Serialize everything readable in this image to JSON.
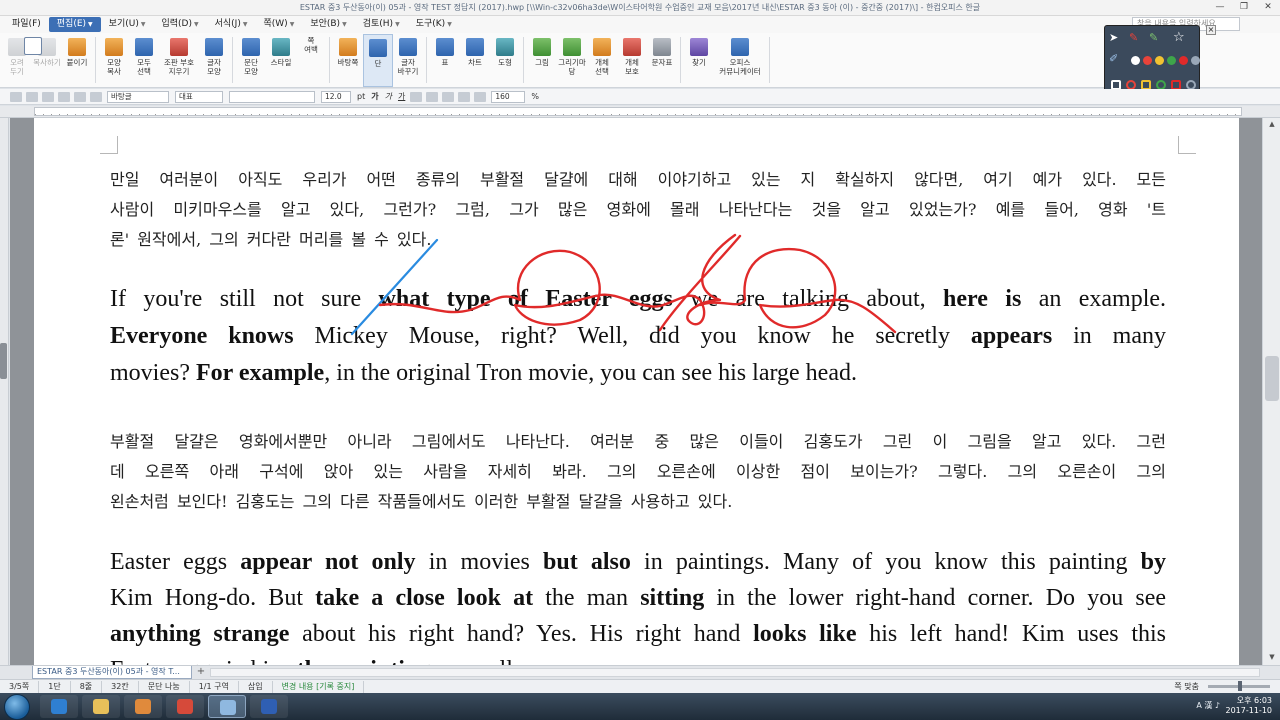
{
  "window": {
    "title": "ESTAR 중3 두산동아(이) 05과 - 영작 TEST 정답지 (2017).hwp [\\\\Win-c32v06ha3de\\W이스타어학원 수업중인 교재 모음\\2017년 내신\\ESTAR 중3 동아 (이) - 중간중 (2017)\\] - 한컴오피스 한글",
    "min": "—",
    "max": "❐",
    "close": "✕"
  },
  "menu": {
    "items": [
      {
        "label": "파일(F)",
        "active": false
      },
      {
        "label": "편집(E)",
        "active": true
      },
      {
        "label": "보기(U)",
        "active": false
      },
      {
        "label": "입력(D)",
        "active": false
      },
      {
        "label": "서식(J)",
        "active": false
      },
      {
        "label": "쪽(W)",
        "active": false
      },
      {
        "label": "보안(B)",
        "active": false
      },
      {
        "label": "검토(H)",
        "active": false
      },
      {
        "label": "도구(K)",
        "active": false
      }
    ],
    "search_placeholder": "찾을 내용을 입력하세요"
  },
  "ribbon": {
    "buttons": [
      {
        "label": "오려\n두기",
        "icon": "scissors-icon",
        "color": "gray",
        "dim": true
      },
      {
        "label": "복사하기",
        "icon": "copy-icon",
        "color": "gray",
        "dim": true
      },
      {
        "label": "붙이기",
        "icon": "paste-icon",
        "color": "orange",
        "dim": false
      },
      {
        "label": "모양\n복사",
        "icon": "format-painter-icon",
        "color": "orange",
        "dim": false
      },
      {
        "label": "모두\n선택",
        "icon": "select-all-icon",
        "color": "blue",
        "dim": false
      },
      {
        "label": "조판 부호\n지우기",
        "icon": "clear-format-icon",
        "color": "red",
        "dim": false
      },
      {
        "label": "글자\n모양",
        "icon": "char-shape-icon",
        "color": "blue",
        "dim": false
      },
      {
        "label": "문단\n모양",
        "icon": "para-shape-icon",
        "color": "blue",
        "dim": false
      },
      {
        "label": "스타일",
        "icon": "style-icon",
        "color": "teal",
        "dim": false
      },
      {
        "label": "쪽\n여백",
        "icon": "page-margin-icon",
        "color": "page",
        "dim": false
      },
      {
        "label": "바탕쪽",
        "icon": "master-page-icon",
        "color": "orange",
        "dim": false
      },
      {
        "label": "단",
        "icon": "columns-icon",
        "color": "blue",
        "dim": false,
        "selected": true
      },
      {
        "label": "글자\n바꾸기",
        "icon": "replace-char-icon",
        "color": "blue",
        "dim": false
      },
      {
        "label": "표",
        "icon": "table-icon",
        "color": "blue",
        "dim": false
      },
      {
        "label": "차트",
        "icon": "chart-icon",
        "color": "blue",
        "dim": false
      },
      {
        "label": "도형",
        "icon": "shape-icon",
        "color": "teal",
        "dim": false
      },
      {
        "label": "그림",
        "icon": "picture-icon",
        "color": "green",
        "dim": false
      },
      {
        "label": "그리기마당",
        "icon": "clipart-icon",
        "color": "green",
        "dim": false
      },
      {
        "label": "개체\n선택",
        "icon": "object-select-icon",
        "color": "orange",
        "dim": false
      },
      {
        "label": "개체\n보호",
        "icon": "object-protect-icon",
        "color": "red",
        "dim": false
      },
      {
        "label": "문자표",
        "icon": "symbol-icon",
        "color": "gray",
        "dim": false
      },
      {
        "label": "찾기",
        "icon": "binoculars-icon",
        "color": "purple",
        "dim": false
      },
      {
        "label": "오피스\n커뮤니케이터",
        "icon": "communicator-icon",
        "color": "blue",
        "dim": false
      }
    ]
  },
  "format_bar": {
    "style": "바탕글",
    "font_lang": "대표",
    "font": "",
    "size": "12.0",
    "size_unit": "pt",
    "bold": "가",
    "italic": "가",
    "underline": "가",
    "zoom": "160",
    "zoom_unit": "%"
  },
  "document": {
    "para1_ko": [
      "만일 여러분이 아직도 우리가 어떤 종류의 부활절 달걀에 대해 이야기하고 있는 지 확실하지 않다면, 여기 예가 있다. 모든",
      "사람이 미키마우스를 알고 있다, 그런가? 그럼, 그가 많은 영화에 몰래 나타난다는 것을 알고 있었는가? 예를 들어, 영화 '트",
      "론' 원작에서, 그의 커다란 머리를 볼 수 있다."
    ],
    "para2_en": [
      [
        {
          "t": "If you're still not sure ",
          "b": false
        },
        {
          "t": "what type of Easter eggs",
          "b": true
        },
        {
          "t": " we are talking about, ",
          "b": false
        },
        {
          "t": "here is",
          "b": true
        },
        {
          "t": " an example.",
          "b": false
        }
      ],
      [
        {
          "t": "Everyone knows",
          "b": true
        },
        {
          "t": " Mickey Mouse, right? Well, did you know he secretly ",
          "b": false
        },
        {
          "t": "appears",
          "b": true
        },
        {
          "t": " in many",
          "b": false
        }
      ],
      [
        {
          "t": "movies? ",
          "b": false
        },
        {
          "t": "For example",
          "b": true
        },
        {
          "t": ", in the original Tron movie, you can see his large head.",
          "b": false
        }
      ]
    ],
    "para3_ko": [
      "부활절 달걀은 영화에서뿐만 아니라 그림에서도 나타난다. 여러분 중 많은 이들이 김홍도가 그린 이 그림을 알고 있다. 그런",
      "데 오른쪽 아래 구석에 앉아 있는 사람을 자세히 봐라. 그의 오른손에 이상한 점이 보이는가? 그렇다. 그의 오른손이 그의",
      "왼손처럼 보인다! 김홍도는 그의 다른 작품들에서도 이러한 부활절 달걀을 사용하고 있다."
    ],
    "para4_en": [
      [
        {
          "t": "Easter eggs ",
          "b": false
        },
        {
          "t": "appear not only",
          "b": true
        },
        {
          "t": " in movies ",
          "b": false
        },
        {
          "t": "but also",
          "b": true
        },
        {
          "t": " in paintings. Many of you know this painting ",
          "b": false
        },
        {
          "t": "by",
          "b": true
        }
      ],
      [
        {
          "t": "Kim Hong-do. But ",
          "b": false
        },
        {
          "t": "take a close look at",
          "b": true
        },
        {
          "t": " the man ",
          "b": false
        },
        {
          "t": "sitting",
          "b": true
        },
        {
          "t": " in the lower right-hand corner. Do you see",
          "b": false
        }
      ],
      [
        {
          "t": "anything strange",
          "b": true
        },
        {
          "t": " about his right hand? Yes. His right hand ",
          "b": false
        },
        {
          "t": "looks like",
          "b": true
        },
        {
          "t": " his left hand! Kim uses this",
          "b": false
        }
      ],
      [
        {
          "t": "Easter eggs in his ",
          "b": false
        },
        {
          "t": "other paintings",
          "b": true
        },
        {
          "t": " as well.",
          "b": false
        }
      ]
    ]
  },
  "doc_tab": {
    "label": "ESTAR 중3 두산동아(이) 05과 - 영작 T..."
  },
  "status_bar": {
    "page": "3/5쪽",
    "section": "1단",
    "line": "8줄",
    "col": "32칸",
    "para_break": "문단 나눔",
    "section_no": "1/1 구역",
    "mode": "삽입",
    "track_changes": "변경 내용 [기록 중지]",
    "view_mode": "쪽 맞춤"
  },
  "taskbar": {
    "time": "오후 6:03",
    "date": "2017-11-10",
    "ime": "A 漢 ♪ ",
    "apps": [
      {
        "name": "ie-icon",
        "color": "#2f7fd1"
      },
      {
        "name": "folder-icon",
        "color": "#e8c05a"
      },
      {
        "name": "media-player-icon",
        "color": "#e08a3c"
      },
      {
        "name": "chrome-icon",
        "color": "#d64a3a"
      },
      {
        "name": "hwp-editor-icon",
        "color": "#8fb8e0"
      },
      {
        "name": "word-icon",
        "color": "#2f5fb3"
      }
    ]
  },
  "pen_tools": {
    "colors": [
      "#ffffff",
      "#e8433a",
      "#f1c232",
      "#3ea54a",
      "#e02a2a",
      "#9aa8b8"
    ]
  }
}
